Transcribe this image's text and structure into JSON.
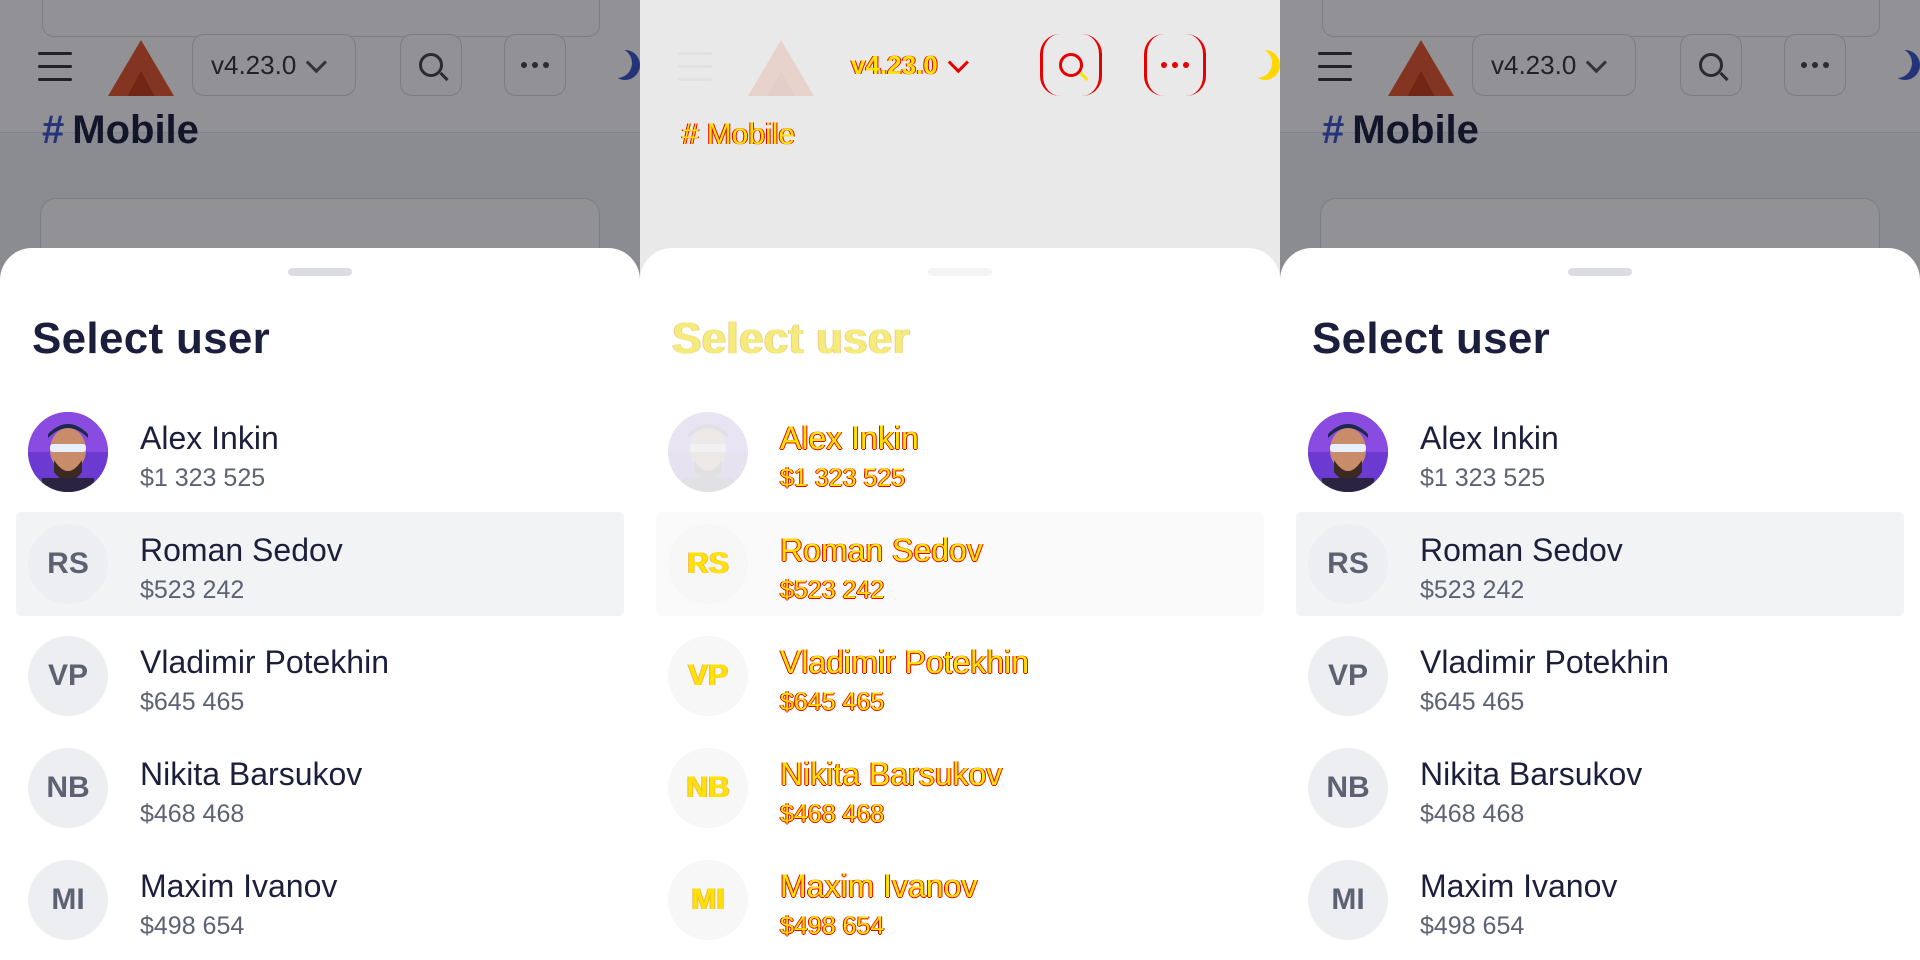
{
  "header": {
    "version": "v4.23.0",
    "logo_icon": "taiga-logo-icon",
    "menu_icon": "hamburger-menu-icon",
    "search_icon": "search-icon",
    "more_icon": "more-horizontal-icon",
    "theme_icon": "moon-icon"
  },
  "page": {
    "heading_prefix": "#",
    "heading": "Mobile"
  },
  "sheet": {
    "title": "Select user",
    "users": [
      {
        "name": "Alex Inkin",
        "balance": "$1 323 525",
        "initials": "",
        "avatar": "photo",
        "selected": false
      },
      {
        "name": "Roman Sedov",
        "balance": "$523 242",
        "initials": "RS",
        "avatar": "initials",
        "selected": true
      },
      {
        "name": "Vladimir Potekhin",
        "balance": "$645 465",
        "initials": "VP",
        "avatar": "initials",
        "selected": false
      },
      {
        "name": "Nikita Barsukov",
        "balance": "$468 468",
        "initials": "NB",
        "avatar": "initials",
        "selected": false
      },
      {
        "name": "Maxim Ivanov",
        "balance": "$498 654",
        "initials": "MI",
        "avatar": "initials",
        "selected": false
      }
    ]
  },
  "colors": {
    "accent": "#3b54c8",
    "logo": "#e8582a",
    "text": "#1b1f3b",
    "secondary_text": "#5d6273",
    "selected_row": "#f2f3f5",
    "glitch_red": "#e60000",
    "glitch_yellow": "#ffe300"
  }
}
